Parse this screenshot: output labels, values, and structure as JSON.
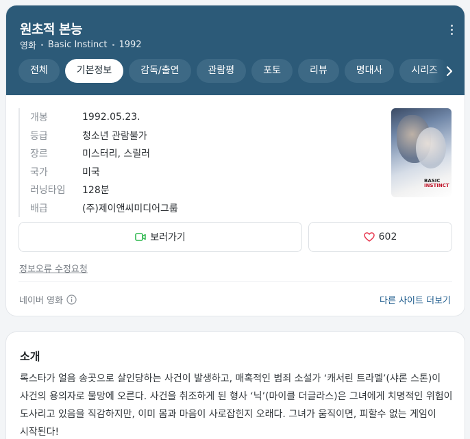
{
  "header": {
    "title": "원초적 본능",
    "subtitle": {
      "category": "영화",
      "original_title": "Basic Instinct",
      "year": "1992"
    },
    "colors": {
      "background": "#2c5a78",
      "tab_bg": "#3d6985"
    }
  },
  "tabs": [
    {
      "label": "전체",
      "active": false
    },
    {
      "label": "기본정보",
      "active": true
    },
    {
      "label": "감독/출연",
      "active": false
    },
    {
      "label": "관람평",
      "active": false
    },
    {
      "label": "포토",
      "active": false
    },
    {
      "label": "리뷰",
      "active": false
    },
    {
      "label": "명대사",
      "active": false
    },
    {
      "label": "시리즈",
      "active": false
    }
  ],
  "info": [
    {
      "key": "개봉",
      "value": "1992.05.23."
    },
    {
      "key": "등급",
      "value": "청소년 관람불가"
    },
    {
      "key": "장르",
      "value": "미스터리, 스릴러"
    },
    {
      "key": "국가",
      "value": "미국"
    },
    {
      "key": "러닝타임",
      "value": "128분"
    },
    {
      "key": "배급",
      "value": "(주)제이앤씨미디어그룹"
    }
  ],
  "poster": {
    "line1": "BASIC",
    "line2": "INSTINCT"
  },
  "actions": {
    "watch_label": "보러가기",
    "like_count": "602",
    "watch_icon": "video-icon",
    "like_icon": "heart-icon"
  },
  "footer": {
    "report_label": "정보오류 수정요청",
    "source_label": "네이버 영화",
    "more_label": "다른 사이트 더보기"
  },
  "synopsis": {
    "title": "소개",
    "text": "록스타가 얼음 송곳으로 살인당하는 사건이 발생하고, 매혹적인 범죄 소설가 ‘캐서린 트라멜’(샤론 스톤)이 사건의 용의자로 물망에 오른다. 사건을 취조하게 된 형사 ‘닉’(마이클 더글라스)은 그녀에게 치명적인 위험이 도사리고 있음을 직감하지만, 이미 몸과 마음이 사로잡힌지 오래다. 그녀가 움직이면, 피할수 없는 게임이 시작된다!"
  }
}
